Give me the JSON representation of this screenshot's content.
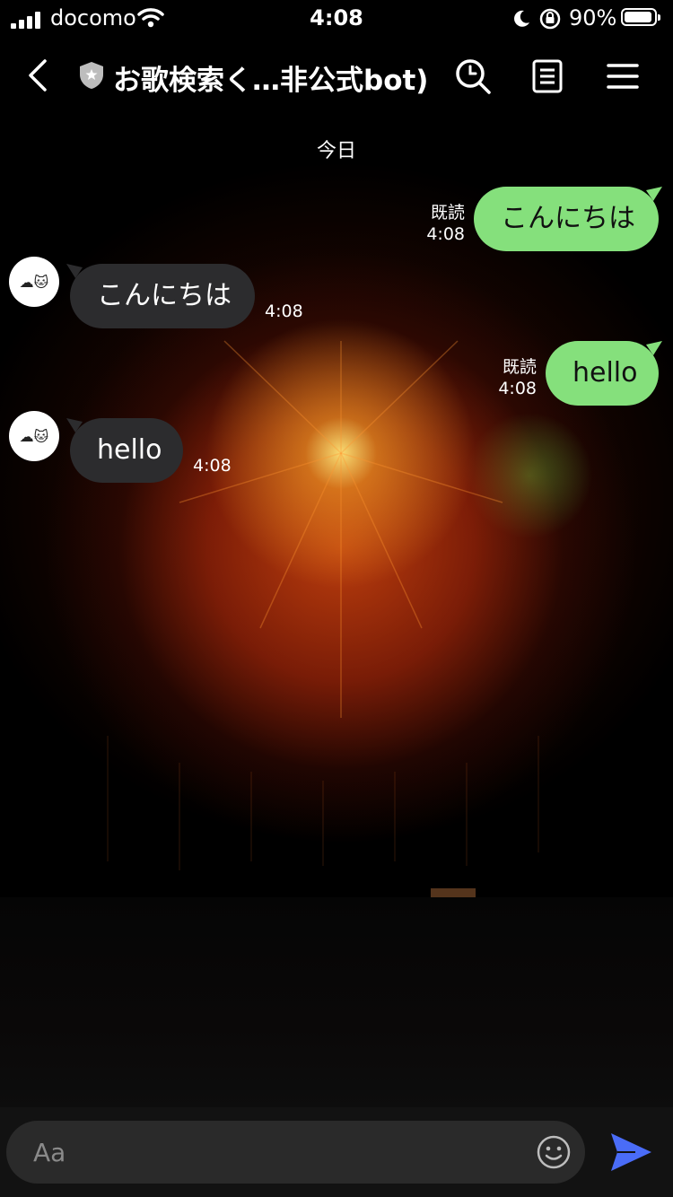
{
  "status_bar": {
    "carrier": "docomo",
    "time": "4:08",
    "battery_percent": "90%"
  },
  "header": {
    "title": "お歌検索く…非公式bot)",
    "icons": [
      "back-icon",
      "shield-icon",
      "search-icon",
      "notes-icon",
      "menu-icon"
    ]
  },
  "chat": {
    "date_label": "今日",
    "messages": [
      {
        "direction": "out",
        "text": "こんにちは",
        "read": "既読",
        "time": "4:08"
      },
      {
        "direction": "in",
        "text": "こんにちは",
        "time": "4:08"
      },
      {
        "direction": "out",
        "text": "hello",
        "read": "既読",
        "time": "4:08"
      },
      {
        "direction": "in",
        "text": "hello",
        "time": "4:08"
      }
    ]
  },
  "input": {
    "placeholder": "Aa",
    "value": ""
  },
  "colors": {
    "outgoing_bubble": "#85e07c",
    "incoming_bubble": "#2c2c2e",
    "send_button": "#4a6cf7"
  }
}
